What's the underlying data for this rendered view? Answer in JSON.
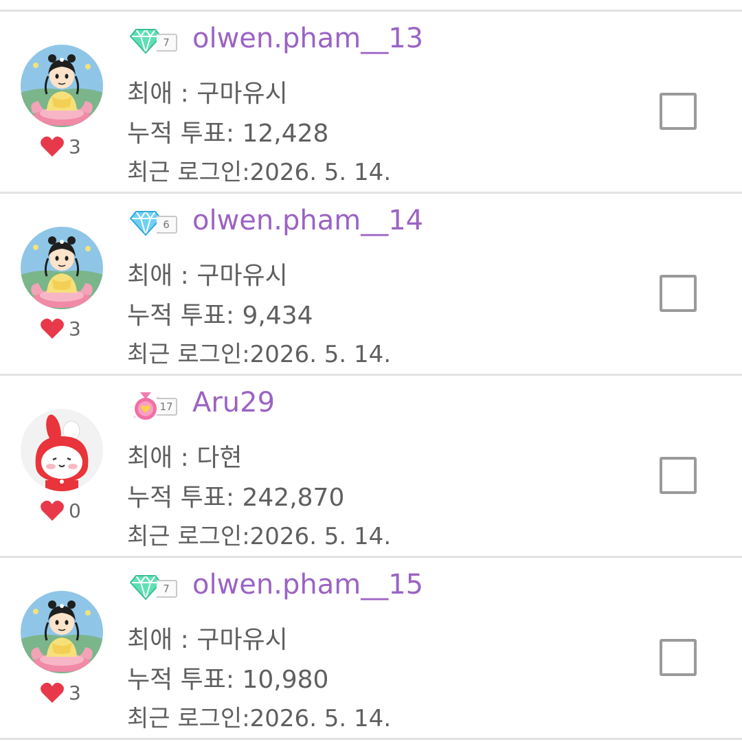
{
  "users": [
    {
      "username": "olwen.pham__13",
      "badge_level": "7",
      "badge_icon": "green-diamond",
      "favorite": "최애 : 구마유시",
      "votes": "누적 투표: 12,428",
      "last_login": "최근 로그인:2026. 5. 14.",
      "likes": "3",
      "avatar": "girl-on-lotus"
    },
    {
      "username": "olwen.pham__14",
      "badge_level": "6",
      "badge_icon": "blue-diamond",
      "favorite": "최애 : 구마유시",
      "votes": "누적 투표: 9,434",
      "last_login": "최근 로그인:2026. 5. 14.",
      "likes": "3",
      "avatar": "girl-on-lotus"
    },
    {
      "username": "Aru29",
      "badge_level": "17",
      "badge_icon": "pink-medal",
      "favorite": "최애 : 다현",
      "votes": "누적 투표: 242,870",
      "last_login": "최근 로그인:2026. 5. 14.",
      "likes": "0",
      "avatar": "bunny-in-red-hood"
    },
    {
      "username": "olwen.pham__15",
      "badge_level": "7",
      "badge_icon": "green-diamond",
      "favorite": "최애 : 구마유시",
      "votes": "누적 투표: 10,980",
      "last_login": "최근 로그인:2026. 5. 14.",
      "likes": "3",
      "avatar": "girl-on-lotus"
    }
  ],
  "colors": {
    "username": "#9b63c4",
    "text": "#5f5f5f",
    "heart": "#e8394a",
    "divider": "#e2e2e2",
    "checkbox_border": "#9a9a9a"
  }
}
